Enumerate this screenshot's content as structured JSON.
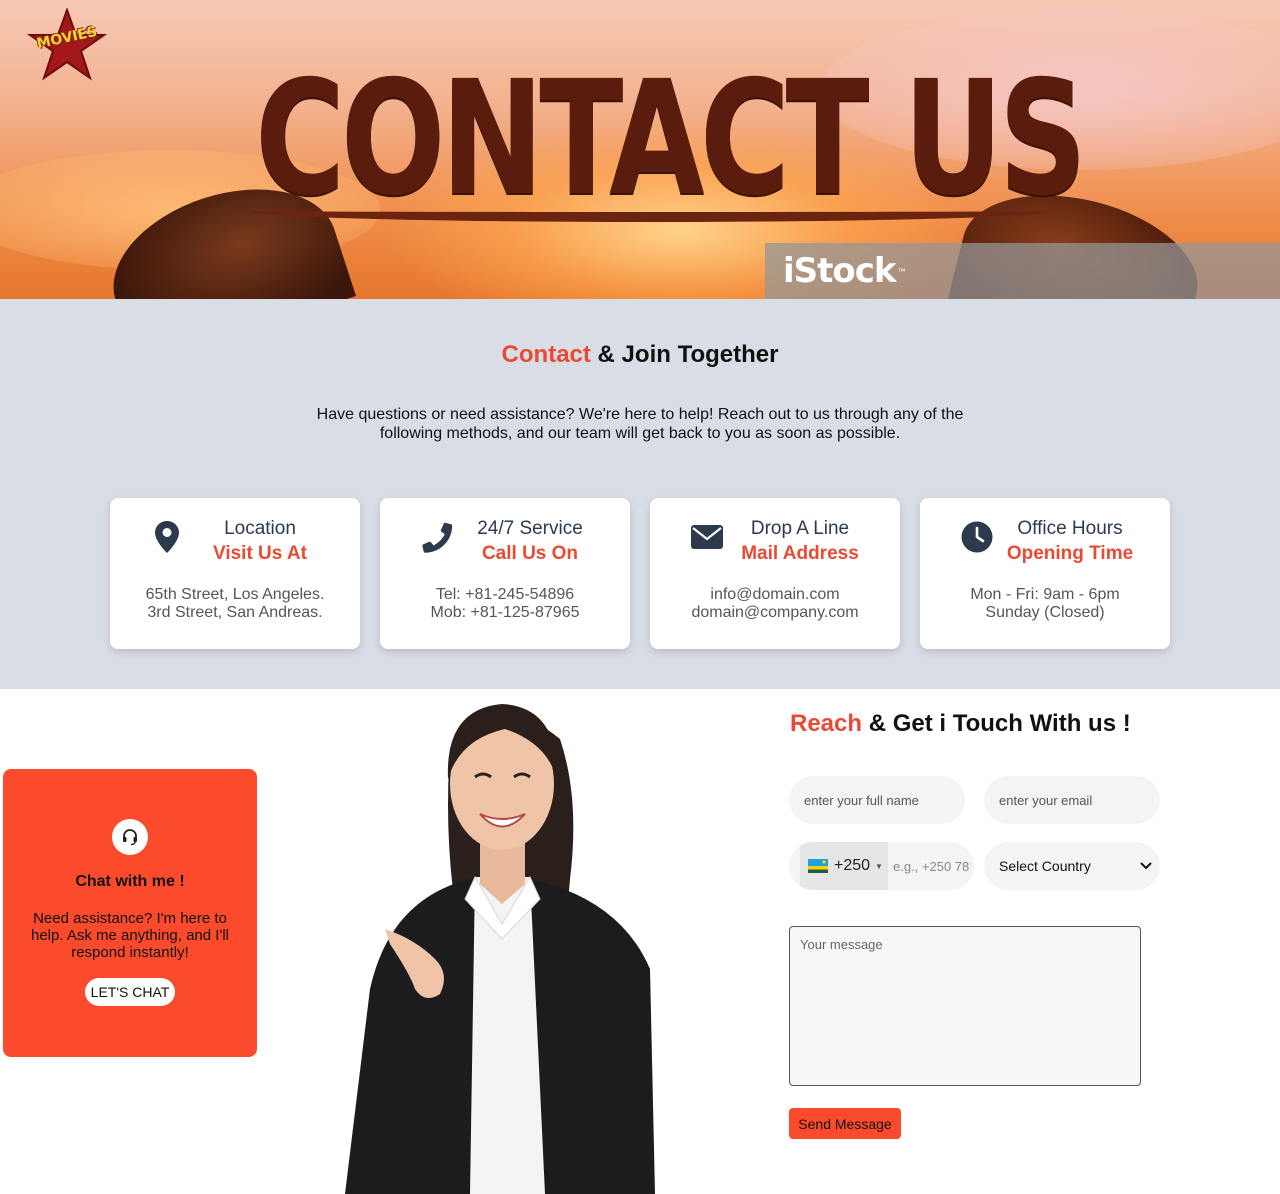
{
  "hero": {
    "title": "CONTACT US",
    "watermark": "iStock",
    "logo_text": "MOVIES"
  },
  "contact": {
    "title_accent": "Contact",
    "title_rest": " & Join Together",
    "description": "Have questions or need assistance? We're here to help! Reach out to us through any of the following methods, and our team will get back to you as soon as possible.",
    "cards": [
      {
        "icon": "location-pin-icon",
        "heading": "Location",
        "subheading": "Visit Us At",
        "line1": "65th Street, Los Angeles.",
        "line2": "3rd Street, San Andreas."
      },
      {
        "icon": "phone-icon",
        "heading": "24/7 Service",
        "subheading": "Call Us On",
        "line1": "Tel: +81-245-54896",
        "line2": "Mob: +81-125-87965"
      },
      {
        "icon": "envelope-icon",
        "heading": "Drop A Line",
        "subheading": "Mail Address",
        "line1": "info@domain.com",
        "line2": "domain@company.com"
      },
      {
        "icon": "clock-icon",
        "heading": "Office Hours",
        "subheading": "Opening Time",
        "line1": "Mon - Fri: 9am - 6pm",
        "line2": "Sunday (Closed)"
      }
    ]
  },
  "chat": {
    "icon": "headset-icon",
    "title": "Chat with me !",
    "description": "Need assistance? I'm here to help. Ask me anything, and I'll respond instantly!",
    "button": "LET'S CHAT"
  },
  "form": {
    "title_accent": "Reach",
    "title_rest": " & Get i Touch With us !",
    "name_placeholder": "enter your full name",
    "email_placeholder": "enter your email",
    "phone_code": "+250",
    "phone_placeholder": "e.g., +250 78",
    "country_selected": "Select Country",
    "message_placeholder": "Your message",
    "send_label": "Send Message"
  },
  "colors": {
    "accent": "#e84a33",
    "chat_bg": "#fb4b2c",
    "section_bg": "#d9dde5",
    "heading_dark": "#2d3a4e"
  }
}
